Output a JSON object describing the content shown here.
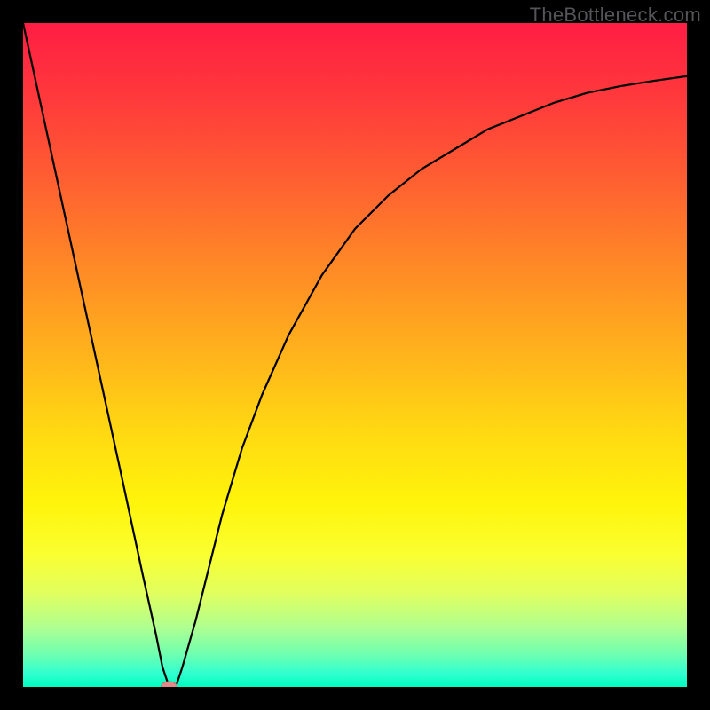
{
  "watermark": "TheBottleneck.com",
  "colors": {
    "frame": "#000000",
    "curve": "#000000",
    "marker_fill": "#e28a8a",
    "marker_stroke": "#c36f6f",
    "gradient_top": "#ff1d44",
    "gradient_bottom": "#00ffc0"
  },
  "chart_data": {
    "type": "line",
    "title": "",
    "xlabel": "",
    "ylabel": "",
    "xlim": [
      0,
      100
    ],
    "ylim": [
      0,
      100
    ],
    "grid": false,
    "legend": false,
    "marker": {
      "x": 22,
      "y": 0,
      "shape": "ellipse"
    },
    "series": [
      {
        "name": "curve",
        "x": [
          0,
          5,
          10,
          15,
          18,
          20,
          21,
          22,
          23,
          24,
          26,
          28,
          30,
          33,
          36,
          40,
          45,
          50,
          55,
          60,
          65,
          70,
          75,
          80,
          85,
          90,
          95,
          100
        ],
        "y": [
          100,
          77,
          54,
          31,
          17,
          8,
          3,
          0,
          0,
          3,
          10,
          18,
          26,
          36,
          44,
          53,
          62,
          69,
          74,
          78,
          81,
          84,
          86,
          88,
          89.5,
          90.5,
          91.3,
          92
        ]
      }
    ]
  }
}
